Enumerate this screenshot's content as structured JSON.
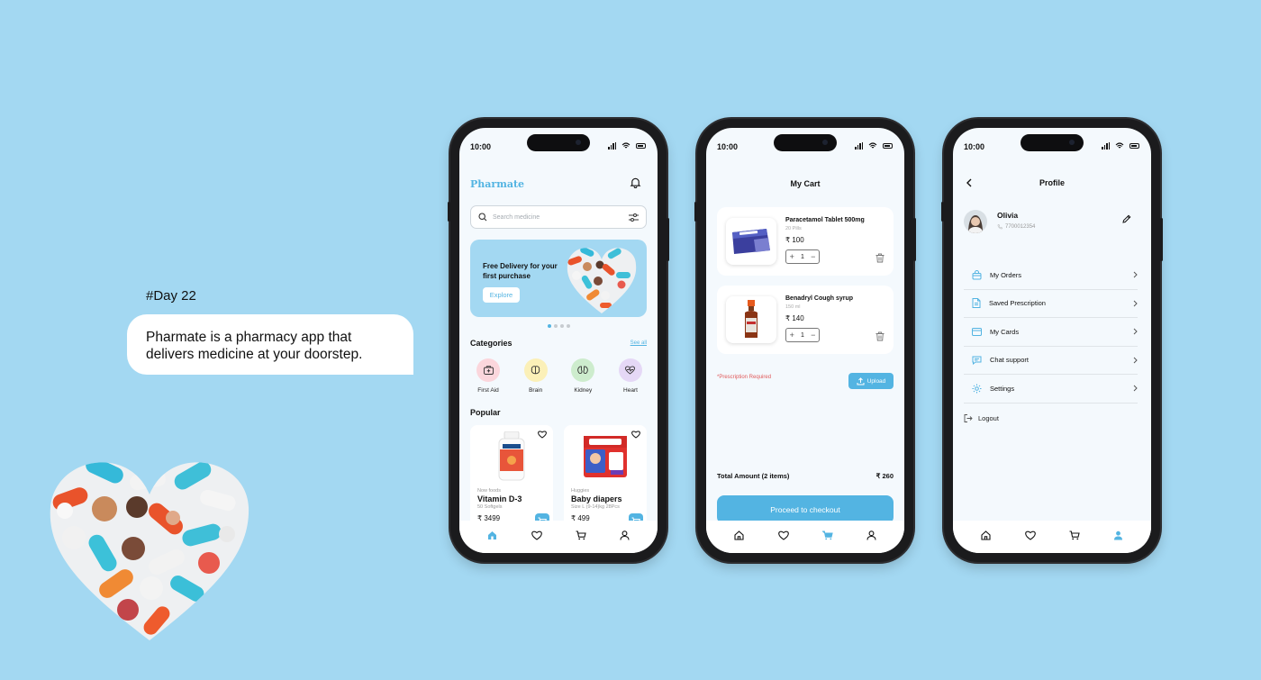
{
  "intro": {
    "day": "#Day 22",
    "description": "Pharmate is a pharmacy app that delivers medicine at your doorstep."
  },
  "colors": {
    "accent": "#53b4e2",
    "background": "#a3d8f2",
    "warning": "#e05a5a"
  },
  "status_bar": {
    "time": "10:00"
  },
  "home": {
    "brand": "Pharmate",
    "search_placeholder": "Search medicine",
    "banner": {
      "text": "Free Delivery for your first purchase",
      "button": "Explore"
    },
    "carousel": {
      "pages": 4,
      "active": 0
    },
    "categories_title": "Categories",
    "see_all": "See all",
    "categories": [
      {
        "label": "First Aid",
        "icon": "first-aid-kit-icon",
        "color": "#fbd6dc"
      },
      {
        "label": "Brain",
        "icon": "brain-icon",
        "color": "#fbf0b8"
      },
      {
        "label": "Kidney",
        "icon": "kidney-icon",
        "color": "#cdeccd"
      },
      {
        "label": "Heart",
        "icon": "heart-icon",
        "color": "#e5d8f6"
      }
    ],
    "popular_title": "Popular",
    "products": [
      {
        "brand": "Now foods",
        "name": "Vitamin D-3",
        "sub": "50 Softgels",
        "price": "₹ 3499"
      },
      {
        "brand": "Huggies",
        "name": "Baby diapers",
        "sub": "Size L (9-14)kg 28Pcs",
        "price": "₹ 499"
      }
    ]
  },
  "cart": {
    "title": "My Cart",
    "items": [
      {
        "name": "Paracetamol Tablet 500mg",
        "sub": "20 Pills",
        "price": "₹ 100",
        "qty": "1"
      },
      {
        "name": "Benadryl Cough syrup",
        "sub": "150 ml",
        "price": "₹ 140",
        "qty": "1"
      }
    ],
    "prescription_required": "*Prescription Required",
    "upload": "Upload",
    "total_label": "Total Amount (2 items)",
    "total_value": "₹ 260",
    "checkout": "Proceed to checkout"
  },
  "profile": {
    "title": "Profile",
    "name": "Olivia",
    "phone": "7700012354",
    "menu": [
      {
        "label": "My Orders",
        "icon": "bag-icon"
      },
      {
        "label": "Saved Prescription",
        "icon": "document-icon"
      },
      {
        "label": "My Cards",
        "icon": "card-icon"
      },
      {
        "label": "Chat support",
        "icon": "chat-icon"
      },
      {
        "label": "Settings",
        "icon": "settings-icon"
      }
    ],
    "logout": "Logout"
  }
}
